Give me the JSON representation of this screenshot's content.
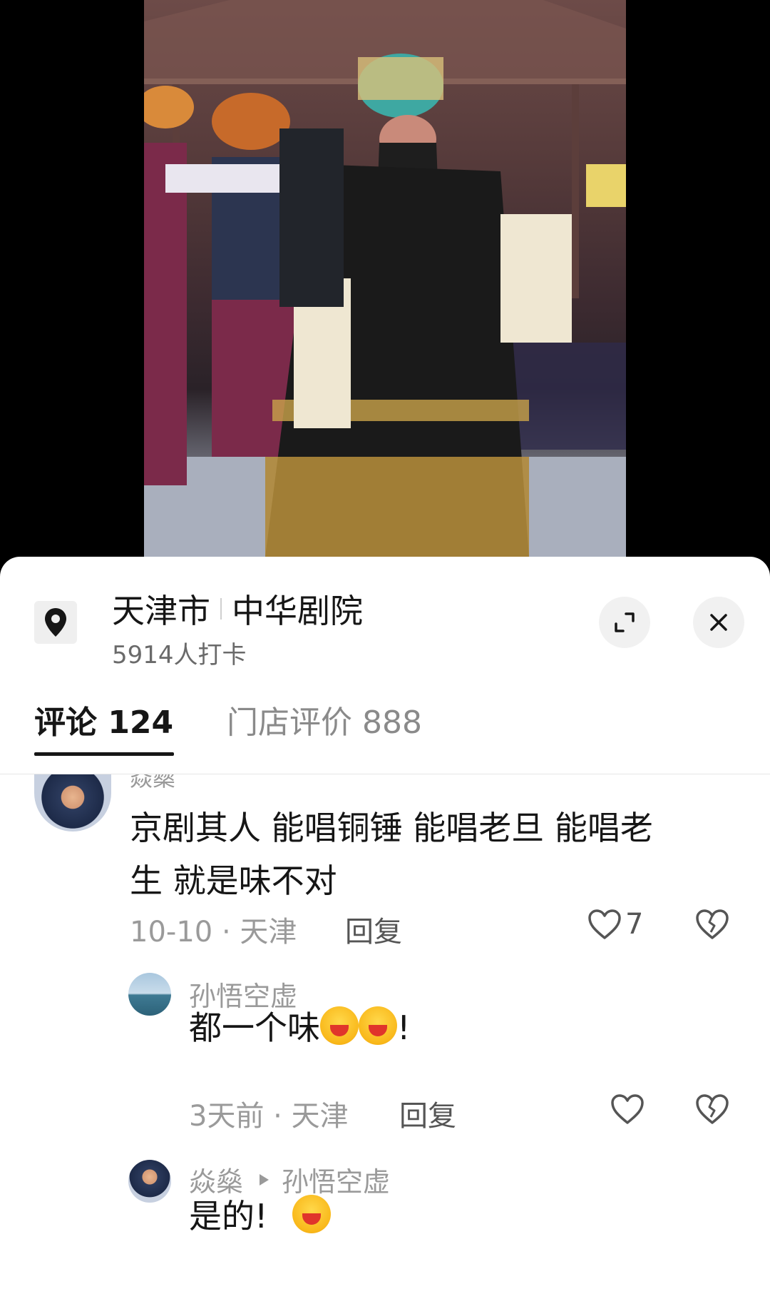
{
  "location": {
    "city": "天津市",
    "venue": "中华剧院",
    "checkins": "5914人打卡"
  },
  "tabs": [
    {
      "label": "评论 124",
      "active": true
    },
    {
      "label": "门店评价 888",
      "active": false
    }
  ],
  "comments": [
    {
      "author": "焱燊",
      "text_line1": "京剧其人 能唱铜锤 能唱老旦 能唱老",
      "text_line2": "生 就是味不对",
      "meta": "10-10 · 天津",
      "reply_label": "回复",
      "likes": "7"
    }
  ],
  "replies": [
    {
      "author": "孙悟空虚",
      "text": "都一个味",
      "text_suffix": "!",
      "meta": "3天前 · 天津",
      "reply_label": "回复"
    },
    {
      "author": "焱燊",
      "reply_to": "孙悟空虚",
      "text": "是的!"
    }
  ],
  "icons": {
    "location": "location-pin-icon",
    "expand": "expand-icon",
    "close": "close-icon",
    "like": "heart-icon",
    "dislike": "broken-heart-icon"
  },
  "colors": {
    "text_primary": "#161616",
    "text_secondary": "#9a9a9a",
    "sheet_bg": "#ffffff"
  }
}
